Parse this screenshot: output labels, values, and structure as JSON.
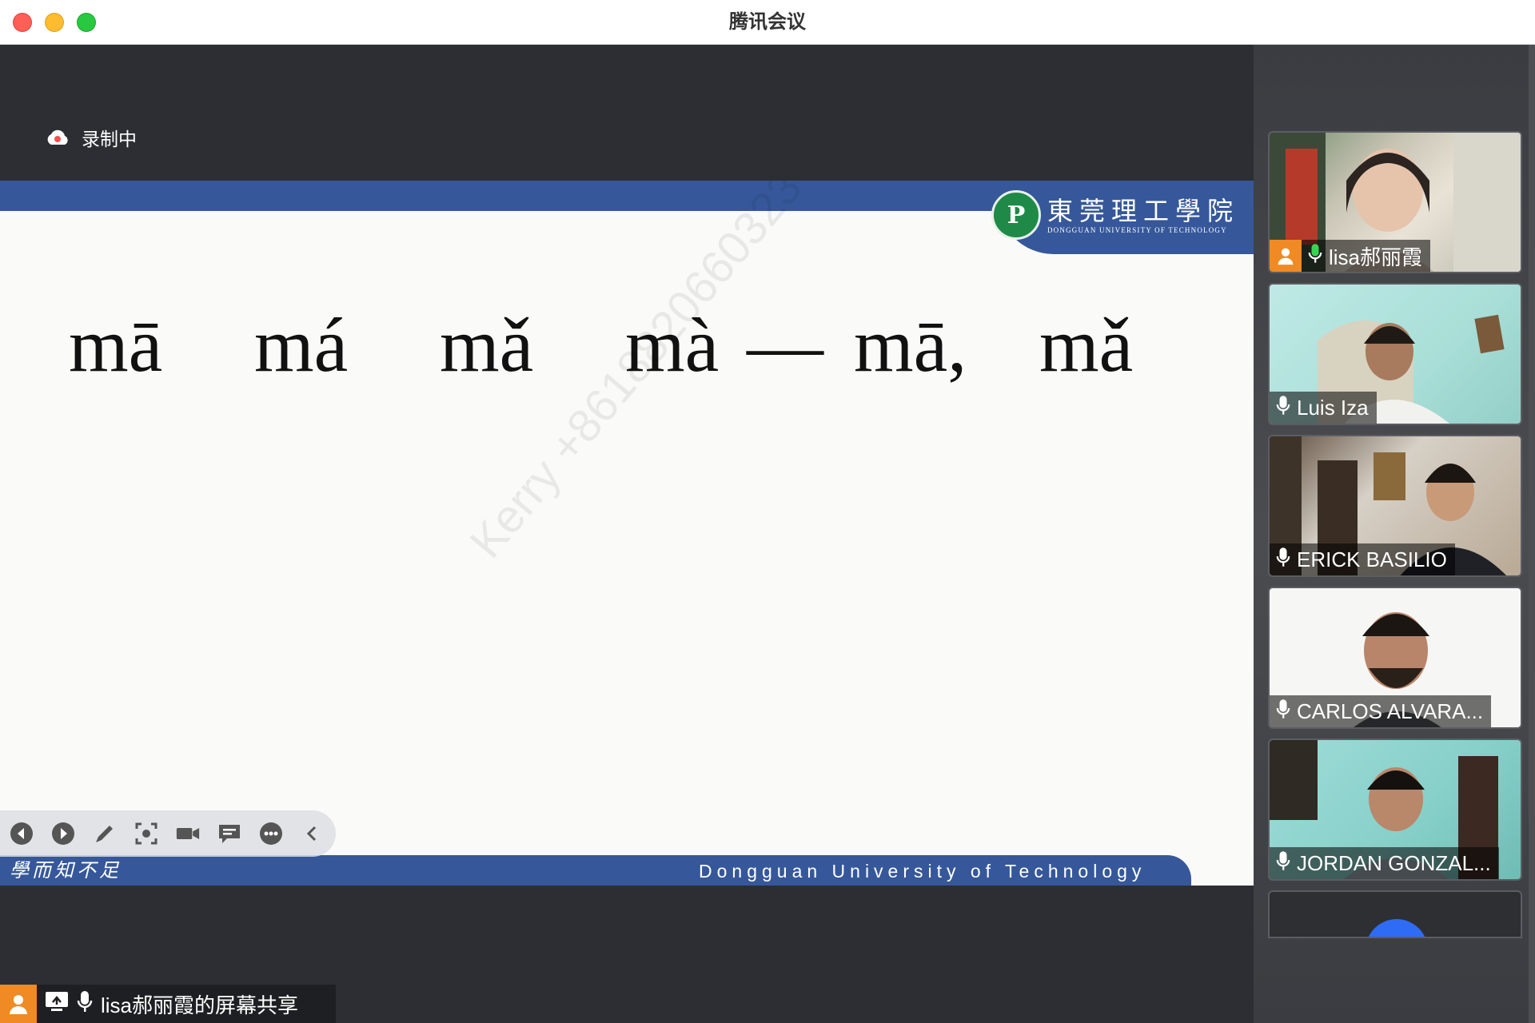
{
  "window": {
    "title": "腾讯会议"
  },
  "recording": {
    "label": "录制中"
  },
  "slide": {
    "logo_seal": "P",
    "logo_cn": "東莞理工學院",
    "logo_en": "DONGGUAN UNIVERSITY OF TECHNOLOGY",
    "pinyin": [
      "mā",
      "má",
      "mǎ",
      "mà",
      "—",
      "mā,",
      "mǎ"
    ],
    "watermark": "Kerry +8618820660323",
    "motto": "學而知不足",
    "footer": "Dongguan University of Technology"
  },
  "share_label": "lisa郝丽霞的屏幕共享",
  "participants": [
    {
      "name": "lisa郝丽霞",
      "host": true
    },
    {
      "name": "Luis Iza",
      "host": false
    },
    {
      "name": "ERICK  BASILIO",
      "host": false
    },
    {
      "name": "CARLOS ALVARA...",
      "host": false
    },
    {
      "name": "JORDAN GONZAL...",
      "host": false
    }
  ],
  "colors": {
    "slide_band": "#36589a",
    "host_badge": "#f08a24",
    "mic_active": "#39d353",
    "avatar_dot": "#2f6cf5"
  }
}
